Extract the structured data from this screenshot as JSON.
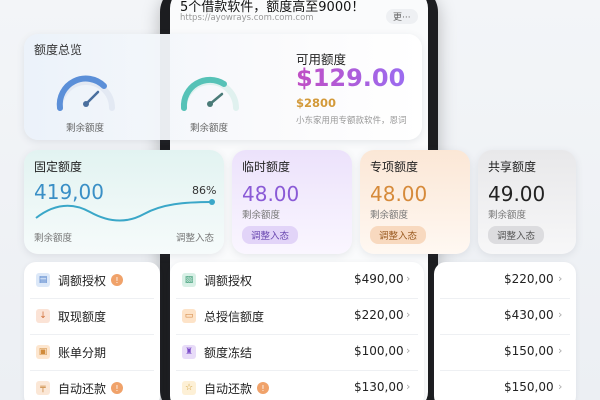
{
  "header": {
    "headline": "5个借款软件，额度高至9000！",
    "url": "https://ayowrays.com.com.com",
    "more_label": "更···"
  },
  "overview": {
    "title": "额度总览",
    "gauges": [
      {
        "label": "剩余额度",
        "color": "#5b8fd8"
      },
      {
        "label": "剩余额度",
        "color": "#56c2b7"
      }
    ],
    "available_title": "可用额度",
    "available_amount": "$129.00",
    "available_sub": "$2800",
    "available_note": "小东家用用专额款软件，恩词"
  },
  "limits": [
    {
      "title": "固定额度",
      "value": "419,00",
      "percent": "86%",
      "sub": "剩余额度",
      "action": "调整入态",
      "accent": "#3a8fc6",
      "bg": "#e4f4f2"
    },
    {
      "title": "临时额度",
      "value": "48.00",
      "sub": "剩余额度",
      "action": "调整入态",
      "accent": "#8a5ad6",
      "bg": "#efe6fb"
    },
    {
      "title": "专项额度",
      "value": "48.00",
      "sub": "剩余额度",
      "action": "调整入态",
      "accent": "#d68a3a",
      "bg": "#fcebdc"
    },
    {
      "title": "共享额度",
      "value": "49.00",
      "sub": "剩余额度",
      "action": "调整入态",
      "accent": "#222222",
      "bg": "#ececee"
    }
  ],
  "left_list": [
    {
      "label": "调额授权",
      "icon": "card-icon",
      "badge": "!"
    },
    {
      "label": "取现额度",
      "icon": "withdraw-icon",
      "badge": ""
    },
    {
      "label": "账单分期",
      "icon": "bill-icon",
      "badge": ""
    },
    {
      "label": "自动还款",
      "icon": "autopay-icon",
      "badge": "!"
    }
  ],
  "mid_list": [
    {
      "label": "调额授权",
      "icon": "image-icon",
      "badge": "",
      "amount": "$490,00"
    },
    {
      "label": "总授信额度",
      "icon": "folder-icon",
      "badge": "",
      "amount": "$220,00"
    },
    {
      "label": "额度冻结",
      "icon": "freeze-icon",
      "badge": "",
      "amount": "$100,00"
    },
    {
      "label": "自动还款",
      "icon": "star-icon",
      "badge": "!",
      "amount": "$130,00"
    }
  ],
  "right_list": [
    {
      "amount": "$220,00"
    },
    {
      "amount": "$430,00"
    },
    {
      "amount": "$150,00"
    },
    {
      "amount": "$150,00"
    }
  ]
}
